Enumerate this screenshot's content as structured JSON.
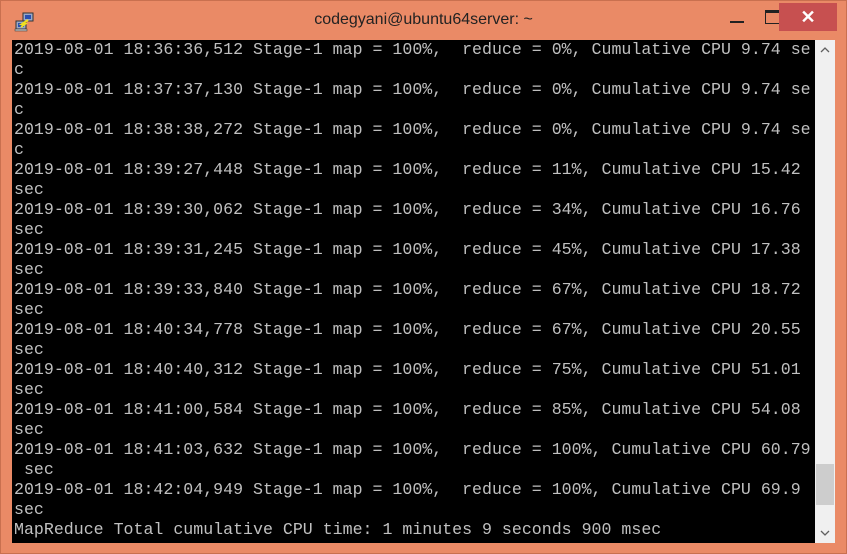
{
  "window": {
    "title": "codegyani@ubuntu64server: ~",
    "app_icon": "putty-icon",
    "controls": {
      "minimize": "minimize-icon",
      "maximize": "maximize-icon",
      "close": "close-icon",
      "close_glyph": "✕"
    },
    "colors": {
      "frame": "#ea8a66",
      "close_button": "#c75050",
      "terminal_bg": "#000000",
      "terminal_fg": "#c0c0c0"
    }
  },
  "terminal": {
    "lines": [
      "2019-08-01 18:36:36,512 Stage-1 map = 100%,  reduce = 0%, Cumulative CPU 9.74 se",
      "c",
      "2019-08-01 18:37:37,130 Stage-1 map = 100%,  reduce = 0%, Cumulative CPU 9.74 se",
      "c",
      "2019-08-01 18:38:38,272 Stage-1 map = 100%,  reduce = 0%, Cumulative CPU 9.74 se",
      "c",
      "2019-08-01 18:39:27,448 Stage-1 map = 100%,  reduce = 11%, Cumulative CPU 15.42",
      "sec",
      "2019-08-01 18:39:30,062 Stage-1 map = 100%,  reduce = 34%, Cumulative CPU 16.76",
      "sec",
      "2019-08-01 18:39:31,245 Stage-1 map = 100%,  reduce = 45%, Cumulative CPU 17.38",
      "sec",
      "2019-08-01 18:39:33,840 Stage-1 map = 100%,  reduce = 67%, Cumulative CPU 18.72",
      "sec",
      "2019-08-01 18:40:34,778 Stage-1 map = 100%,  reduce = 67%, Cumulative CPU 20.55",
      "sec",
      "2019-08-01 18:40:40,312 Stage-1 map = 100%,  reduce = 75%, Cumulative CPU 51.01",
      "sec",
      "2019-08-01 18:41:00,584 Stage-1 map = 100%,  reduce = 85%, Cumulative CPU 54.08",
      "sec",
      "2019-08-01 18:41:03,632 Stage-1 map = 100%,  reduce = 100%, Cumulative CPU 60.79",
      " sec",
      "2019-08-01 18:42:04,949 Stage-1 map = 100%,  reduce = 100%, Cumulative CPU 69.9",
      "sec",
      "MapReduce Total cumulative CPU time: 1 minutes 9 seconds 900 msec"
    ]
  },
  "scrollbar": {
    "up_icon": "chevron-up-icon",
    "down_icon": "chevron-down-icon",
    "up_glyph": "^",
    "down_glyph": "v",
    "position": "bottom"
  }
}
